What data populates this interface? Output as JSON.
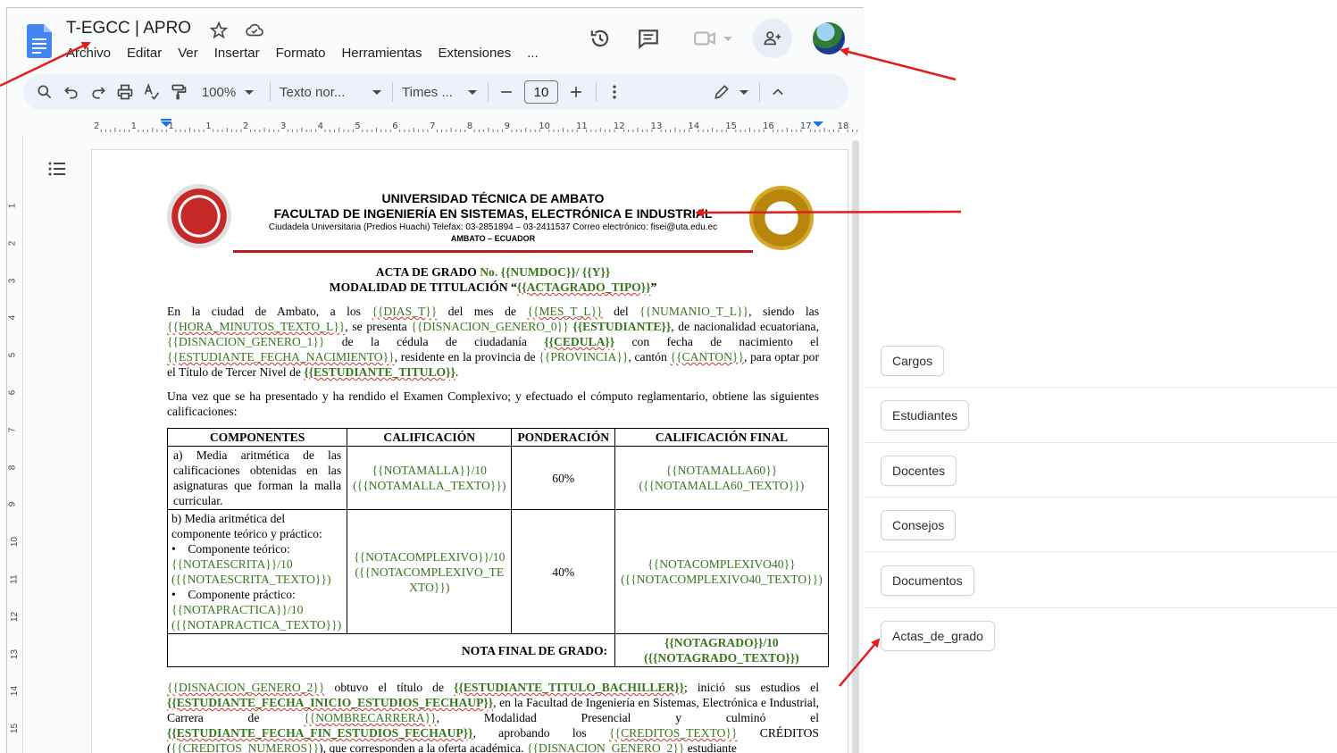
{
  "doc": {
    "title": "T-EGCC | APRO",
    "menu": [
      "Archivo",
      "Editar",
      "Ver",
      "Insertar",
      "Formato",
      "Herramientas",
      "Extensiones",
      "..."
    ],
    "toolbar": {
      "zoom": "100%",
      "style": "Texto nor...",
      "font": "Times ...",
      "font_size": "10"
    },
    "ruler_ticks": [
      "2",
      "1",
      "1",
      "1",
      "2",
      "3",
      "4",
      "5",
      "6",
      "7",
      "8",
      "9",
      "10",
      "11",
      "12",
      "13",
      "14",
      "15",
      "16",
      "17",
      "18"
    ],
    "vruler_ticks": [
      "1",
      "2",
      "3",
      "4",
      "5",
      "6",
      "7",
      "8",
      "9",
      "10",
      "11",
      "12",
      "13",
      "14",
      "15"
    ]
  },
  "letterhead": {
    "line1": "UNIVERSIDAD TÉCNICA DE AMBATO",
    "line2": "FACULTAD DE INGENIERÍA EN SISTEMAS, ELECTRÓNICA E INDUSTRIAL",
    "line3": "Ciudadela Universitaria (Predios Huachi) Telefax: 03-2851894 – 03-2411537 Correo electrónico: fisei@uta.edu.ec",
    "line4": "AMBATO – ECUADOR"
  },
  "acta": {
    "title_prefix": "ACTA DE GRADO ",
    "title_no": "No. ",
    "title_numdoc": "{{NUMDOC}}/ {{Y}}",
    "modalidad_prefix": "MODALIDAD DE TITULACIÓN “",
    "modalidad_var": "{{ACTAGRADO_TIPO}}",
    "modalidad_suffix": "”",
    "p1": {
      "t1": "En la ciudad de Ambato,  a  los ",
      "v1": "{{DIAS_T}}",
      "t2": " del mes de ",
      "v2": "{{MES_T_L}}",
      "t3": " del ",
      "v3": "{{NUMANIO_T_L}}",
      "t4": ", siendo las ",
      "v4": "{{HORA_MINUTOS_TEXTO_L}}",
      "t5": ", se presenta ",
      "v5": "{{DISNACION_GENERO_0}}",
      "t6": " ",
      "v6": "{{ESTUDIANTE}}",
      "t7": ", de nacionalidad ecuatoriana, ",
      "v7": "{{DISNACION_GENERO_1}}",
      "t8": " de la cédula de ciudadanía ",
      "v8": "{{CEDULA}}",
      "t9": " con  fecha de  nacimiento el ",
      "v9": "{{ESTUDIANTE_FECHA_NACIMIENTO}}",
      "t10": ", residente en  la provincia de ",
      "v10": "{{PROVINCIA}}",
      "t11": ", cantón ",
      "v11": "{{CANTON}}",
      "t12": ", para  optar  por el Título de Tercer Nivel de ",
      "v12": "{{ESTUDIANTE_TITULO}}",
      "t13": "."
    },
    "p2": "Una vez que se ha presentado y ha rendido el Examen Complexivo; y efectuado el cómputo reglamentario, obtiene las siguientes calificaciones:",
    "table": {
      "headers": [
        "COMPONENTES",
        "CALIFICACIÓN",
        "PONDERACIÓN",
        "CALIFICACIÓN FINAL"
      ],
      "row1": {
        "comp": "a) Media aritmética de las calificaciones obtenidas en las asignaturas que forman la malla curricular.",
        "cal": "{{NOTAMALLA}}/10 ({{NOTAMALLA_TEXTO}})",
        "pond": "60%",
        "final": "{{NOTAMALLA60}} ({{NOTAMALLA60_TEXTO}})"
      },
      "row2": {
        "comp_a": "b) Media aritmética del componente teórico y práctico:",
        "comp_b": "Componente teórico:",
        "comp_c": "{{NOTAESCRITA}}/10 ({{NOTAESCRITA_TEXTO}})",
        "comp_d": "Componente práctico:",
        "comp_e": "{{NOTAPRACTICA}}/10 ({{NOTAPRACTICA_TEXTO}})",
        "cal": "{{NOTACOMPLEXIVO}}/10 ({{NOTACOMPLEXIVO_TEXTO}})",
        "pond": "40%",
        "final": "{{NOTACOMPLEXIVO40}} ({{NOTACOMPLEXIVO40_TEXTO}})"
      },
      "total_label": "NOTA FINAL DE GRADO:",
      "total_value": "{{NOTAGRADO}}/10 ({{NOTAGRADO_TEXTO}})"
    },
    "p3": {
      "v1": "{{DISNACION_GENERO_2}}",
      "t1": " obtuvo el título de ",
      "v2": "{{ESTUDIANTE_TITULO_BACHILLER}}",
      "t2": "; inició sus estudios el ",
      "v3": "{{ESTUDIANTE_FECHA_INICIO_ESTUDIOS_FECHAUP}}",
      "t3": ", en la Facultad de Ingeniería en Sistemas, Electrónica e Industrial,   Carrera   de   ",
      "v4": "{{NOMBRECARRERA}}",
      "t4": ",   Modalidad   Presencial   y   culminó   el ",
      "v5": "{{ESTUDIANTE_FECHA_FIN_ESTUDIOS_FECHAUP}}",
      "t5": ",  aprobando  los  ",
      "v6": "{{CREDITOS_TEXTO}}",
      "t6": "  CRÉDITOS (",
      "v7": "{{CREDITOS_NUMEROS}}",
      "t7": "), que corresponden a la oferta académica. ",
      "v8": "{{DISNACION_GENERO_2}}",
      "t8": " estudiante"
    }
  },
  "side_panel": {
    "buttons": [
      "Cargos",
      "Estudiantes",
      "Docentes",
      "Consejos",
      "Documentos",
      "Actas_de_grado"
    ]
  },
  "colors": {
    "template_var": "#38761d",
    "arrow": "#e31b1b",
    "letterhead_rule": "#b71c1c",
    "docs_blue": "#4285f4"
  }
}
